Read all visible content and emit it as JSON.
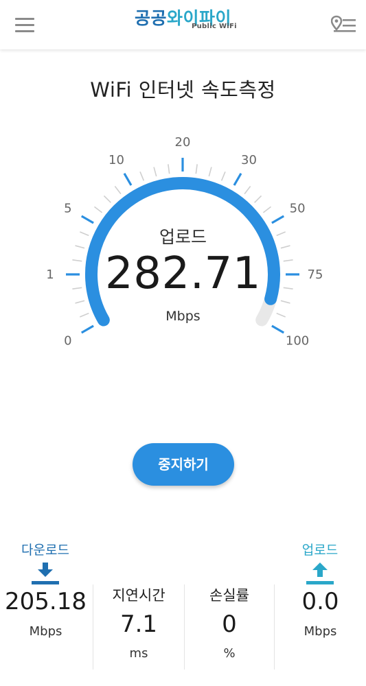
{
  "header": {
    "logo_part1": "공공",
    "logo_part2": "와이파이",
    "logo_sub": "Public WiFi",
    "menu_icon": "hamburger-menu-icon",
    "location_icon": "location-list-icon"
  },
  "title": "WiFi 인터넷 속도측정",
  "gauge": {
    "caption": "업로드",
    "value": "282.71",
    "unit": "Mbps",
    "scale_labels": [
      "0",
      "1",
      "5",
      "10",
      "20",
      "30",
      "50",
      "75",
      "100"
    ],
    "fill_fraction": 0.94,
    "arc_color": "#2b8fe0",
    "track_color": "#e8e8e8"
  },
  "stop_button": {
    "label": "중지하기",
    "color": "#2b8fe0"
  },
  "stats": {
    "download": {
      "label": "다운로드",
      "value": "205.18",
      "unit": "Mbps",
      "icon": "download-arrow-icon",
      "color": "#1f6fb0"
    },
    "latency": {
      "label": "지연시간",
      "value": "7.1",
      "unit": "ms"
    },
    "loss": {
      "label": "손실률",
      "value": "0",
      "unit": "%"
    },
    "upload": {
      "label": "업로드",
      "value": "0.0",
      "unit": "Mbps",
      "icon": "upload-arrow-icon",
      "color": "#2aa7c9"
    }
  }
}
